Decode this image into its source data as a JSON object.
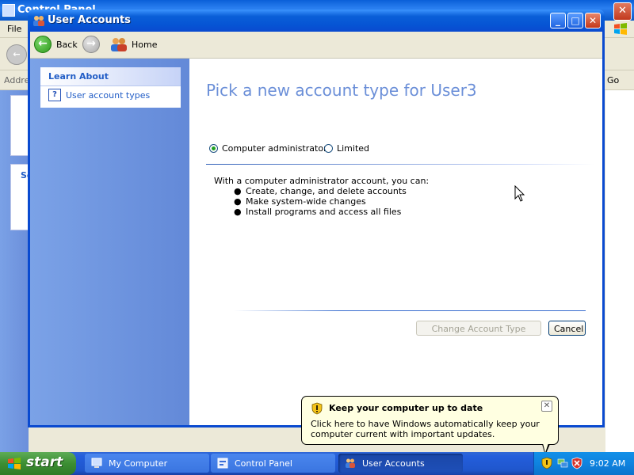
{
  "background_window": {
    "title": "Control Panel",
    "menu_file": "File",
    "address_label": "Address",
    "go_label": "Go",
    "panel_letter": "Se"
  },
  "window": {
    "title": "User Accounts",
    "nav": {
      "back": "Back",
      "home": "Home"
    }
  },
  "sidebar": {
    "heading": "Learn About",
    "items": [
      {
        "label": "User account types",
        "icon": "help-icon"
      }
    ]
  },
  "main": {
    "heading": "Pick a new account type for User3",
    "options": [
      {
        "label": "Computer administrator",
        "checked": true
      },
      {
        "label": "Limited",
        "checked": false
      }
    ],
    "description_intro": "With a computer administrator account, you can:",
    "bullets": [
      "Create, change, and delete accounts",
      "Make system-wide changes",
      "Install programs and access all files"
    ],
    "buttons": {
      "change": {
        "label": "Change Account Type",
        "enabled": false
      },
      "cancel": {
        "label": "Cancel"
      }
    }
  },
  "notification": {
    "title": "Keep your computer up to date",
    "text": "Click here to have Windows automatically keep your computer current with important updates.",
    "icon": "shield-warning-icon"
  },
  "taskbar": {
    "start_label": "start",
    "tasks": [
      {
        "label": "My Computer",
        "active": false
      },
      {
        "label": "Control Panel",
        "active": false
      },
      {
        "label": "User Accounts",
        "active": true
      }
    ],
    "clock": "9:02 AM"
  },
  "colors": {
    "title_blue": "#0a5fd8",
    "heading_blue": "#6b8fd8",
    "link_blue": "#215dc6",
    "pane_blue": "#6c8fdb",
    "start_green": "#3c8e33",
    "balloon_yellow": "#ffffe1"
  }
}
